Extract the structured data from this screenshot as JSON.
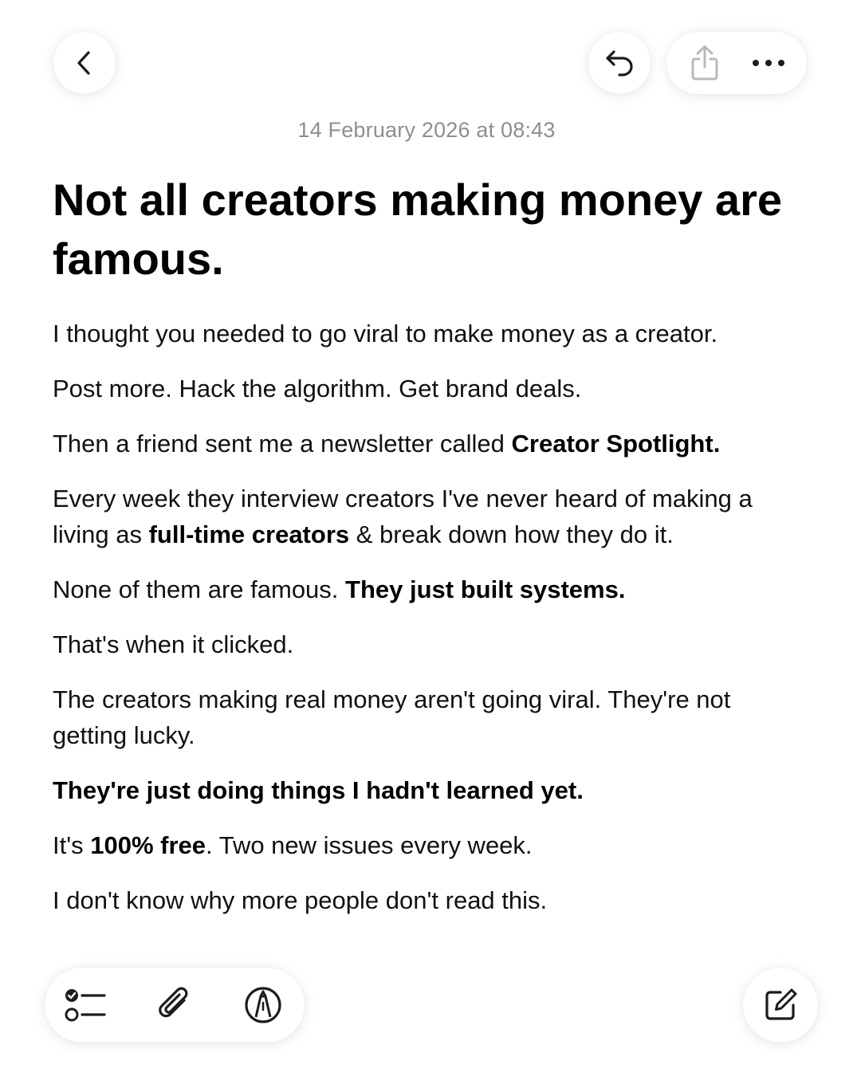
{
  "toolbar": {
    "back_icon": "chevron-left-icon",
    "undo_icon": "undo-icon",
    "share_icon": "share-icon",
    "more_icon": "ellipsis-icon"
  },
  "note": {
    "timestamp": "14 February 2026 at 08:43",
    "title": "Not all creators making money are famous.",
    "p1": "I thought you needed to go viral to make money as a creator.",
    "p2": "Post more. Hack the algorithm. Get brand deals.",
    "p3_text": "Then a friend sent me a newsletter called ",
    "p3_bold": "Creator Spotlight.",
    "p4_text_a": "Every week they interview creators I've never heard of making a living as ",
    "p4_bold": "full-time creators",
    "p4_text_b": " & break down how they do it.",
    "p5_text": "None of them are famous. ",
    "p5_bold": "They just built systems.",
    "p6": "That's when it clicked.",
    "p7": "The creators making real money aren't going viral. They're not getting lucky.",
    "p8_bold": "They're just doing things I hadn't learned yet.",
    "p9_text_a": "It's ",
    "p9_bold": "100% free",
    "p9_text_b": ". Two new issues every week.",
    "p10": "I don't know why more people don't read this."
  },
  "bottom_bar": {
    "checklist_icon": "checklist-icon",
    "attachment_icon": "paperclip-icon",
    "markup_icon": "markup-pen-icon",
    "compose_icon": "compose-icon"
  },
  "colors": {
    "timestamp": "#8e8e93",
    "text": "#111111",
    "icon": "#1c1c1e",
    "icon_disabled": "#b8b8bd"
  }
}
